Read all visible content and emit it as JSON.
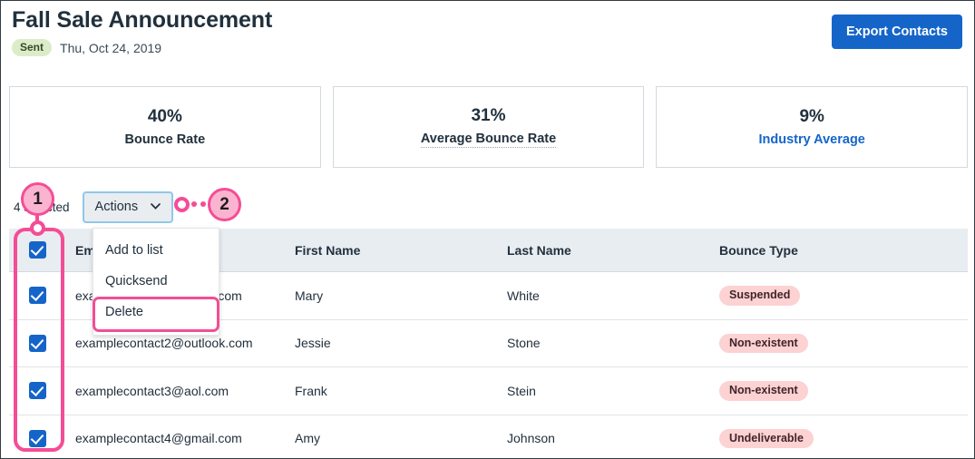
{
  "header": {
    "title": "Fall Sale Announcement",
    "status": "Sent",
    "date": "Thu, Oct 24, 2019",
    "export_label": "Export Contacts"
  },
  "stats": [
    {
      "value": "40%",
      "label": "Bounce Rate",
      "style": "plain"
    },
    {
      "value": "31%",
      "label": "Average Bounce Rate",
      "style": "dotted"
    },
    {
      "value": "9%",
      "label": "Industry Average",
      "style": "link"
    }
  ],
  "toolbar": {
    "selected_count": "4 selected",
    "actions_label": "Actions",
    "chevron": "⌄"
  },
  "menu": {
    "items": [
      {
        "label": "Add to list"
      },
      {
        "label": "Quicksend"
      },
      {
        "label": "Delete"
      }
    ]
  },
  "table": {
    "columns": [
      "Email",
      "First Name",
      "Last Name",
      "Bounce Type"
    ],
    "rows": [
      {
        "checked": true,
        "email": "examplecontact1@gmail.com",
        "first": "Mary",
        "last": "White",
        "type": "Suspended"
      },
      {
        "checked": true,
        "email": "examplecontact2@outlook.com",
        "first": "Jessie",
        "last": "Stone",
        "type": "Non-existent"
      },
      {
        "checked": true,
        "email": "examplecontact3@aol.com",
        "first": "Frank",
        "last": "Stein",
        "type": "Non-existent"
      },
      {
        "checked": true,
        "email": "examplecontact4@gmail.com",
        "first": "Amy",
        "last": "Johnson",
        "type": "Undeliverable"
      }
    ]
  },
  "annotations": {
    "callout_1": "1",
    "callout_2": "2"
  },
  "colors": {
    "accent_blue": "#1565c9",
    "annotation_pink": "#f44d96",
    "badge_green": "#dcecc8",
    "pill_pink": "#fcd2d2"
  }
}
